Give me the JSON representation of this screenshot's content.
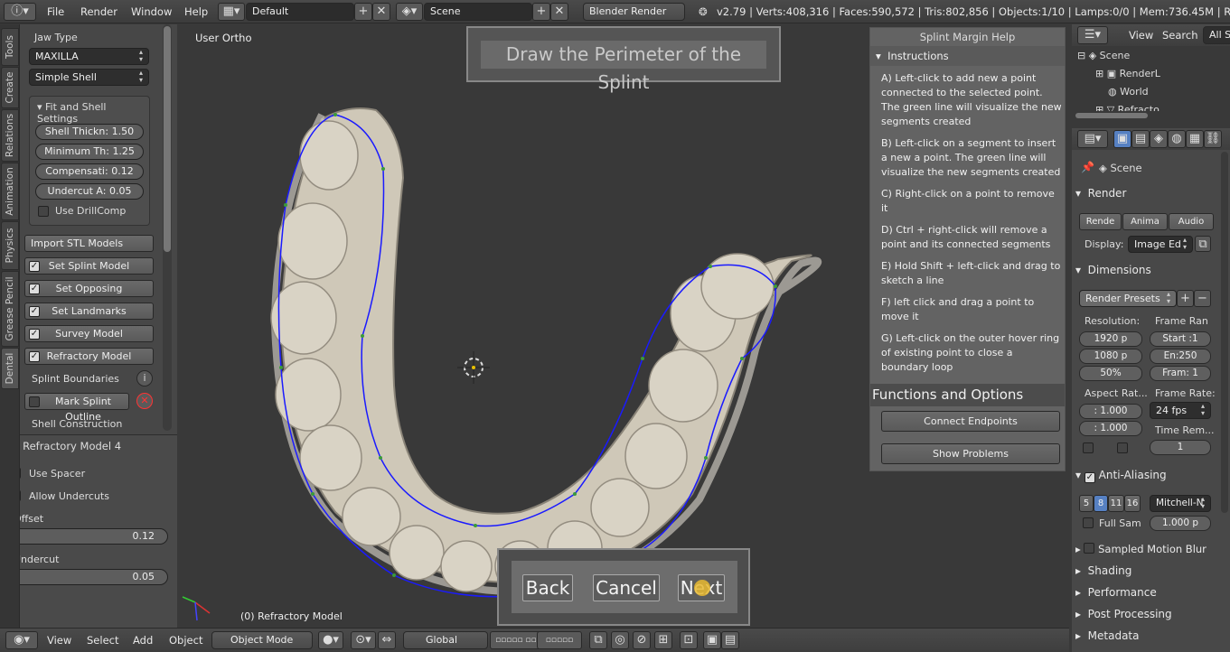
{
  "topbar": {
    "menus": [
      "File",
      "Render",
      "Window",
      "Help"
    ],
    "layout": "Default",
    "scene": "Scene",
    "engine": "Blender Render",
    "stats": "v2.79 | Verts:408,316 | Faces:590,572 | Tris:802,856 | Objects:1/10 | Lamps:0/0 | Mem:736.45M | Refractory"
  },
  "left_tabs": [
    "Tools",
    "Create",
    "Relations",
    "Animation",
    "Physics",
    "Grease Pencil",
    "Dental"
  ],
  "toolshelf": {
    "jaw_type_label": "Jaw Type",
    "jaw_type": "MAXILLA",
    "shell_type": "Simple Shell",
    "fit_header": "Fit and Shell Settings",
    "fields": [
      {
        "label": "Shell Thickn:",
        "value": "1.50"
      },
      {
        "label": "Minimum Th:",
        "value": "1.25"
      },
      {
        "label": "Compensati:",
        "value": "0.12"
      },
      {
        "label": "Undercut A:",
        "value": "0.05"
      }
    ],
    "drillcomp": "Use DrillComp",
    "import_stl": "Import STL Models",
    "steps": [
      "Set Splint Model",
      "Set Opposing",
      "Set Landmarks",
      "Survey Model",
      "Refractory Model"
    ],
    "splint_boundaries": "Splint Boundaries",
    "mark_outline": "Mark Splint Outline",
    "shell_construction": "Shell Construction"
  },
  "operator": {
    "title": "Refractory Model 4",
    "use_spacer": "Use Spacer",
    "allow_undercuts": "Allow Undercuts",
    "offset_label": "Offset",
    "offset_value": "0.12",
    "undercut_label": "Undercut",
    "undercut_value": "0.05"
  },
  "viewport": {
    "view_name": "User Ortho",
    "object_name": "(0) Refractory Model",
    "banner": "Draw the Perimeter of the Splint",
    "back": "Back",
    "cancel": "Cancel",
    "next": "Next"
  },
  "help_panel": {
    "title": "Splint Margin Help",
    "instructions_header": "Instructions",
    "items": [
      "A) Left-click to add new a point connected to the selected point. The green line will visualize the new segments created",
      "B) Left-click on a segment to insert a new a point. The green line will visualize the new segments created",
      "C) Right-click on a point to remove it",
      "D) Ctrl + right-click will remove a point and its connected segments",
      "E) Hold Shift + left-click and drag to sketch a line",
      "F) left click and drag a point to move it",
      "G) Left-click on the outer hover ring of existing point to close a boundary loop"
    ],
    "functions_header": "Functions and Options",
    "connect": "Connect Endpoints",
    "problems": "Show Problems"
  },
  "bottombar": {
    "menus": [
      "View",
      "Select",
      "Add",
      "Object"
    ],
    "mode": "Object Mode",
    "orientation": "Global"
  },
  "outliner": {
    "menus": [
      "View",
      "Search"
    ],
    "filter": "All S",
    "items": [
      "Scene",
      "RenderL",
      "World",
      "Refracto"
    ]
  },
  "properties": {
    "scene": "Scene",
    "render_header": "Render",
    "render_tabs": [
      "Rende",
      "Anima",
      "Audio"
    ],
    "display_label": "Display:",
    "display_value": "Image Ed",
    "dimensions_header": "Dimensions",
    "render_presets": "Render Presets",
    "resolution_label": "Resolution:",
    "frame_range_label": "Frame Ran",
    "res_x": "1920 p",
    "res_y": "1080 p",
    "res_pct": "50%",
    "start": "Start :1",
    "end": "En:250",
    "frame": "Fram: 1",
    "aspect_label": "Aspect Rat...",
    "aspect_x": ": 1.000",
    "aspect_y": ": 1.000",
    "framerate_label": "Frame Rate:",
    "framerate": "24 fps",
    "time_remap_label": "Time Rem...",
    "time_remap": "1",
    "aa_header": "Anti-Aliasing",
    "aa_samples": [
      "5",
      "8",
      "11",
      "16"
    ],
    "aa_filter": "Mitchell-N",
    "full_sample": "Full Sam",
    "filter_size": "1.000 p",
    "sampled_motion": "Sampled Motion Blur",
    "shading": "Shading",
    "performance": "Performance",
    "post_processing": "Post Processing",
    "metadata": "Metadata"
  },
  "colors": {
    "accent_blue": "#5680c2",
    "spline_blue": "#1a1aff",
    "point_green": "#3a9a3a",
    "teeth": "#d8d2c4"
  }
}
